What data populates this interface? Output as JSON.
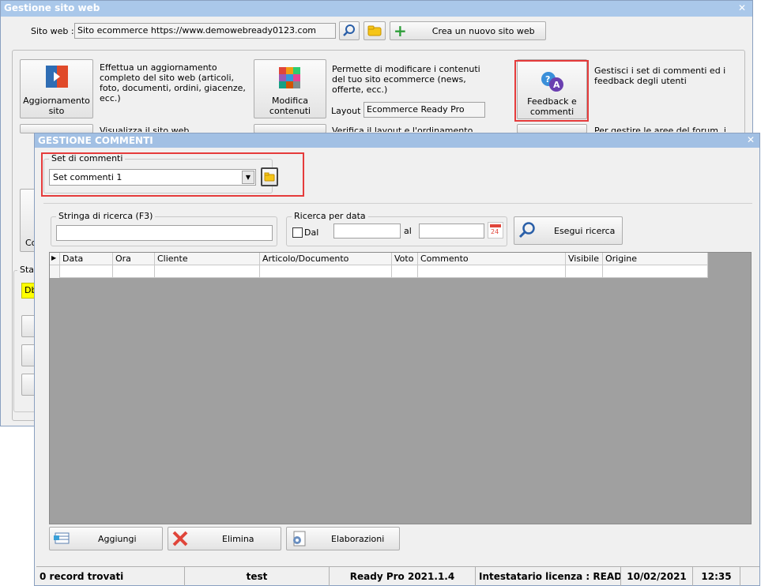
{
  "back_window": {
    "title": "Gestione sito web",
    "site_label": "Sito web :",
    "site_value": "Sito ecommerce https://www.demowebready0123.com",
    "new_site_label": "Crea un nuovo sito web",
    "update_label": "Aggiornamento sito",
    "update_desc": "Effettua un aggiornamento completo del sito web (articoli, foto, documenti, ordini, giacenze, ecc.)",
    "modify_label": "Modifica contenuti",
    "modify_desc": "Permette di modificare i contenuti del tuo sito ecommerce (news, offerte, ecc.)",
    "layout_label": "Layout :",
    "layout_value": "Ecommerce Ready Pro",
    "feedback_label": "Feedback e commenti",
    "feedback_desc": "Gestisci i set di commenti ed i feedback degli utenti",
    "partial_1": "Visualizza il sito web",
    "partial_2": "Verifica il layout e l'ordinamento",
    "partial_3": "Per gestire le aree del forum, i",
    "partial_4": "Co",
    "partial_5": "Stat",
    "partial_6": "Db"
  },
  "dialog": {
    "title": "GESTIONE COMMENTI",
    "set_group_label": "Set di commenti",
    "set_selected": "Set commenti 1",
    "search_group_label": "Stringa di ricerca (F3)",
    "search_value": "",
    "date_group_label": "Ricerca per data",
    "dal_label": "Dal",
    "al_label": "al",
    "date_from": "",
    "date_to": "",
    "calendar_day": "24",
    "run_search_label": "Esegui ricerca",
    "columns": [
      "Data",
      "Ora",
      "Cliente",
      "Articolo/Documento",
      "Voto",
      "Commento",
      "Visibile",
      "Origine"
    ],
    "add_label": "Aggiungi",
    "delete_label": "Elimina",
    "process_label": "Elaborazioni"
  },
  "status": {
    "records": "0 record trovati",
    "user": "test",
    "version": "Ready Pro 2021.1.4",
    "license": "Intestatario licenza : READY TEC",
    "date": "10/02/2021",
    "time": "12:35"
  },
  "colors": {
    "titlebar_back": "#aac8ea",
    "titlebar_front": "#a2c0e4",
    "highlight": "#e53b3b",
    "grid_bg": "#a0a0a0"
  }
}
